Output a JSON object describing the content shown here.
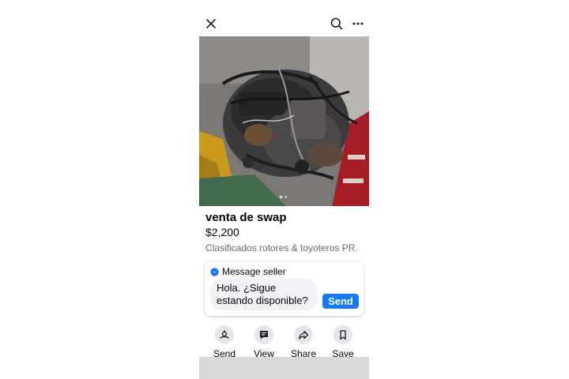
{
  "header": {
    "close_icon": "close-icon",
    "search_icon": "search-icon",
    "more_icon": "more-horizontal-icon"
  },
  "listing": {
    "photo_description": "engine-swap-photo",
    "photo_count": 2,
    "current_photo": 1,
    "title": "venta de swap",
    "price": "$2,200",
    "group": "Clasificados rotores  & toyoteros  PR."
  },
  "message": {
    "header_label": "Message seller",
    "messenger_icon": "messenger-icon",
    "draft_text": "Hola. ¿Sigue estando disponible?",
    "send_label": "Send",
    "accent_color": "#1877f2"
  },
  "actions": [
    {
      "label": "Send",
      "icon": "send-icon"
    },
    {
      "label": "View",
      "icon": "view-icon"
    },
    {
      "label": "Share",
      "icon": "share-icon"
    },
    {
      "label": "Save",
      "icon": "bookmark-icon"
    }
  ]
}
